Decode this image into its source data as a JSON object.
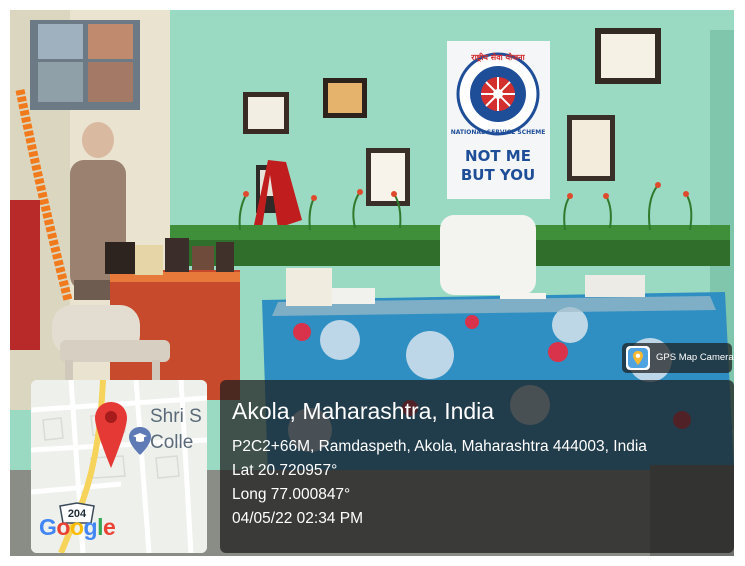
{
  "location": {
    "title": "Akola, Maharashtra, India",
    "address": "P2C2+66M, Ramdaspeth, Akola, Maharashtra 444003, India",
    "latitude": "Lat 20.720957°",
    "longitude": "Long 77.000847°",
    "timestamp": "04/05/22 02:34 PM"
  },
  "app_badge": {
    "label": "GPS Map Camera",
    "icon": "map-pin-camera-icon"
  },
  "mini_map": {
    "place_label_line1": "Shri S",
    "place_label_line2": "Colle",
    "road_number": "204",
    "logo": [
      "G",
      "o",
      "o",
      "g",
      "l",
      "e"
    ],
    "logo_colors": [
      "#4285F4",
      "#EA4335",
      "#FBBC05",
      "#4285F4",
      "#34A853",
      "#EA4335"
    ],
    "pin_color": "#e53935",
    "school_icon": "graduation-cap-icon"
  },
  "poster": {
    "arc_text": "राष्ट्रीय सेवा योजना",
    "ring_text": "NATIONAL SERVICE SCHEME",
    "slogan_line1": "NOT ME",
    "slogan_line2": "BUT YOU"
  },
  "colors": {
    "wall": "#9ad9c2",
    "tablecloth": "#2f8fc2",
    "overlay": "#1c1c1c",
    "nss_blue": "#1f4e99",
    "nss_red": "#d32f2f"
  }
}
